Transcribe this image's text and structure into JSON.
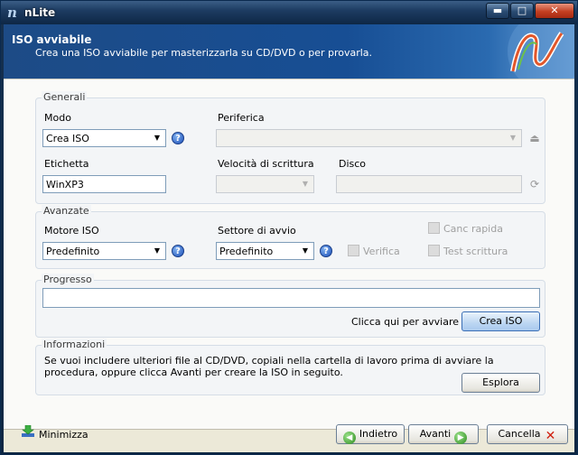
{
  "window": {
    "title": "nLite",
    "buttons": {
      "minimize": "▬",
      "maximize": "□",
      "close": "✕"
    }
  },
  "header": {
    "title": "ISO avviabile",
    "subtitle": "Crea una ISO avviabile per masterizzarla su CD/DVD o per provarla."
  },
  "generali": {
    "group_label": "Generali",
    "modo_label": "Modo",
    "modo_value": "Crea ISO",
    "periferica_label": "Periferica",
    "periferica_value": "",
    "etichetta_label": "Etichetta",
    "etichetta_value": "WinXP3",
    "velocita_label": "Velocità di scrittura",
    "velocita_value": "",
    "disco_label": "Disco",
    "disco_value": ""
  },
  "avanzate": {
    "group_label": "Avanzate",
    "motore_label": "Motore ISO",
    "motore_value": "Predefinito",
    "settore_label": "Settore di avvio",
    "settore_value": "Predefinito",
    "verifica_label": "Verifica",
    "canc_rapida_label": "Canc rapida",
    "test_scrittura_label": "Test scrittura"
  },
  "progresso": {
    "group_label": "Progresso",
    "hint": "Clicca qui per avviare ->",
    "crea_button": "Crea ISO"
  },
  "informazioni": {
    "group_label": "Informazioni",
    "text_line1": "Se vuoi includere ulteriori file al CD/DVD, copiali nella cartella di lavoro prima di avviare la",
    "text_line2": "procedura, oppure clicca Avanti per creare la ISO in seguito.",
    "esplora_button": "Esplora"
  },
  "footer": {
    "minimize_label": "Minimizza",
    "back_button": "Indietro",
    "next_button": "Avanti",
    "cancel_button": "Cancella"
  },
  "icons": {
    "help": "help-icon",
    "periferica": "drive-eject-icon",
    "refresh": "refresh-icon",
    "download": "download-arrow-icon",
    "back": "arrow-left-icon",
    "next": "arrow-right-icon",
    "cancel": "red-x-icon"
  }
}
